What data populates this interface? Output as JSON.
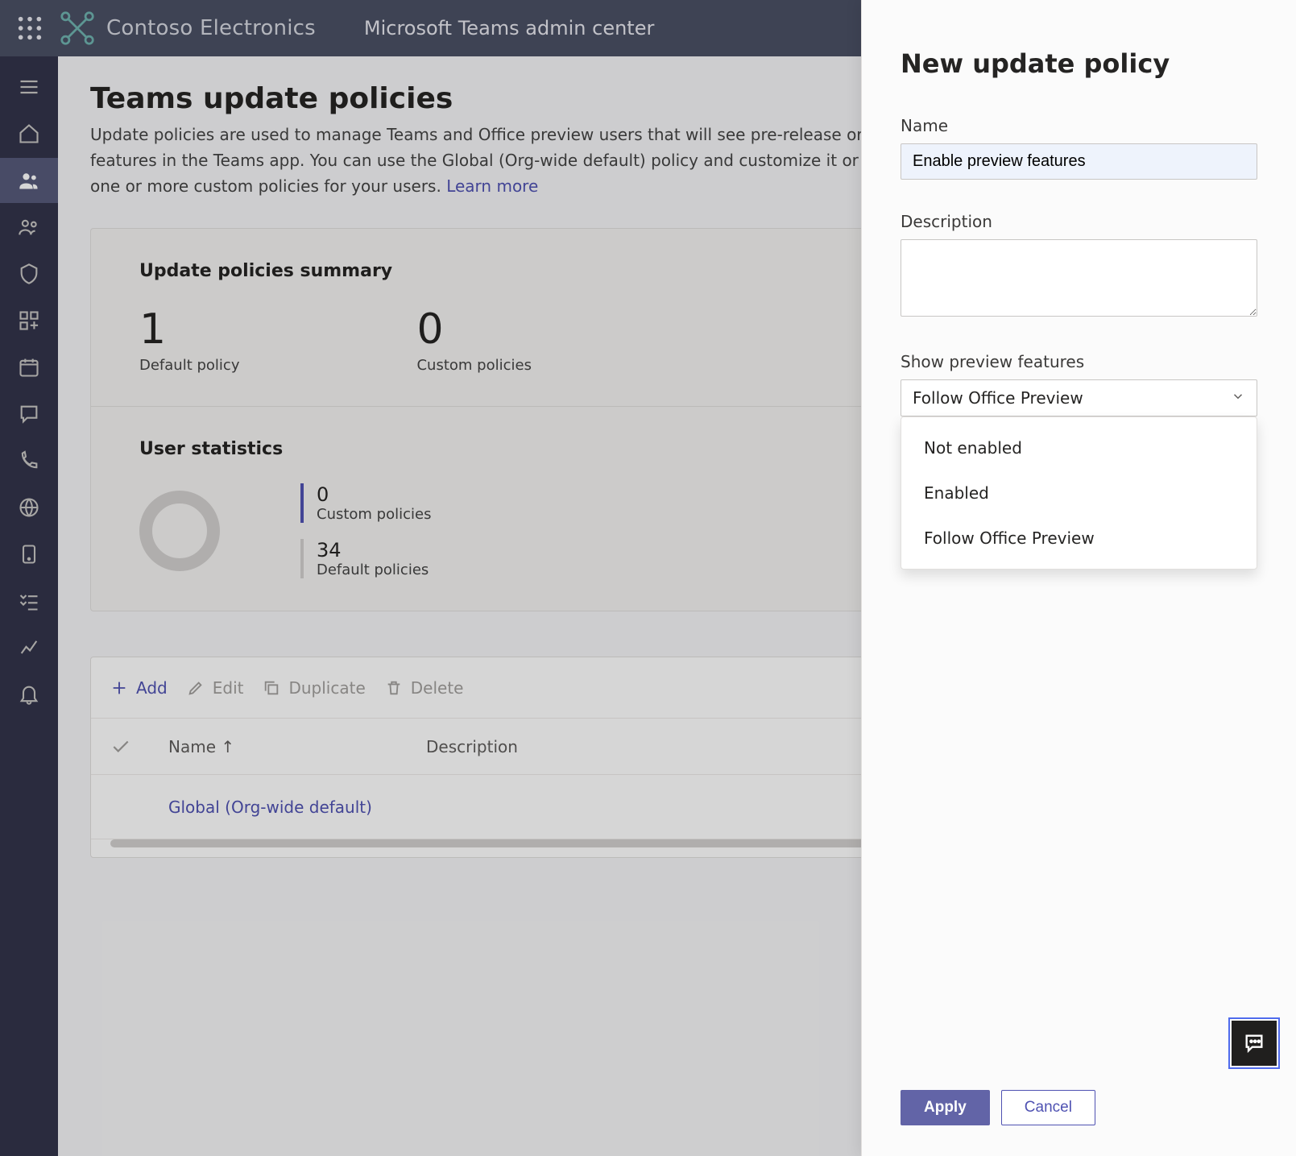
{
  "header": {
    "brand_name": "Contoso Electronics",
    "product_name": "Microsoft Teams admin center"
  },
  "rail": {
    "items": [
      {
        "name": "menu-icon"
      },
      {
        "name": "home-icon"
      },
      {
        "name": "teams-icon",
        "active": true
      },
      {
        "name": "users-icon"
      },
      {
        "name": "devices-icon"
      },
      {
        "name": "apps-icon"
      },
      {
        "name": "calendar-icon"
      },
      {
        "name": "messaging-icon"
      },
      {
        "name": "voice-icon"
      },
      {
        "name": "locations-icon"
      },
      {
        "name": "policy-packages-icon"
      },
      {
        "name": "planning-icon"
      },
      {
        "name": "analytics-icon"
      },
      {
        "name": "notifications-icon"
      }
    ]
  },
  "page": {
    "title": "Teams update policies",
    "description": "Update policies are used to manage Teams and Office preview users that will see pre-release or preview features in the Teams app. You can use the Global (Org-wide default) policy and customize it or create one or more custom policies for your users.",
    "learn_more": "Learn more"
  },
  "summary": {
    "title": "Update policies summary",
    "default_count": "1",
    "default_label": "Default policy",
    "custom_count": "0",
    "custom_label": "Custom policies"
  },
  "user_stats": {
    "title": "User statistics",
    "custom_count": "0",
    "custom_label": "Custom policies",
    "default_count": "34",
    "default_label": "Default policies"
  },
  "toolbar": {
    "add": "Add",
    "edit": "Edit",
    "duplicate": "Duplicate",
    "delete": "Delete"
  },
  "table": {
    "col_name": "Name",
    "col_desc": "Description",
    "row0_name": "Global (Org-wide default)"
  },
  "panel": {
    "title": "New update policy",
    "name_label": "Name",
    "name_value": "Enable preview features",
    "desc_label": "Description",
    "desc_value": "",
    "preview_label": "Show preview features",
    "preview_selected": "Follow Office Preview",
    "options": {
      "0": "Not enabled",
      "1": "Enabled",
      "2": "Follow Office Preview"
    },
    "apply": "Apply",
    "cancel": "Cancel"
  }
}
